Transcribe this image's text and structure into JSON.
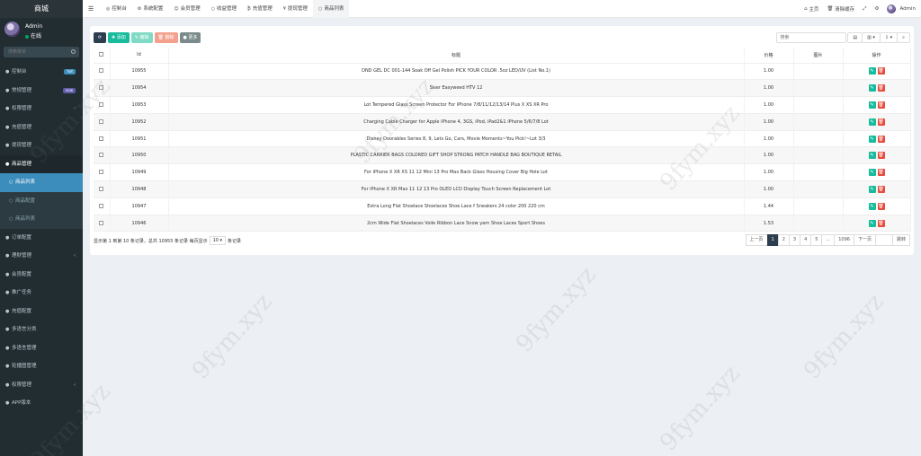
{
  "sidebar": {
    "brand": "商城",
    "user": {
      "name": "Admin",
      "status": "在线"
    },
    "search_placeholder": "搜索菜单",
    "items": [
      {
        "label": "控制台",
        "icon": "dashboard-icon",
        "badge": "hot",
        "badge_color": "#3c8dbc"
      },
      {
        "label": "常规管理",
        "icon": "cog-icon",
        "badge": "new",
        "badge_color": "#605ca8"
      },
      {
        "label": "权限管理",
        "icon": "group-icon",
        "chevron": "‹"
      },
      {
        "label": "充值管理",
        "icon": "money-icon"
      },
      {
        "label": "提现管理",
        "icon": "yen-icon"
      },
      {
        "label": "商品管理",
        "icon": "shop-icon",
        "open": true
      },
      {
        "label": "商品列表",
        "sub": true,
        "active": true
      },
      {
        "label": "商品配置",
        "sub": true
      },
      {
        "label": "商品列表",
        "sub": true
      },
      {
        "label": "订单配置",
        "icon": "circle-icon"
      },
      {
        "label": "理财管理",
        "icon": "list-icon",
        "chevron": "‹"
      },
      {
        "label": "会员配置",
        "icon": "user-icon"
      },
      {
        "label": "推广任务",
        "icon": "link-icon"
      },
      {
        "label": "充值配置",
        "icon": "card-icon"
      },
      {
        "label": "多语言分类",
        "icon": "tag-icon"
      },
      {
        "label": "多语言管理",
        "icon": "edit-icon"
      },
      {
        "label": "轮播图管理",
        "icon": "image-icon"
      },
      {
        "label": "权限管理",
        "icon": "users-icon",
        "chevron": "‹"
      },
      {
        "label": "APP版本",
        "icon": "circle-icon"
      }
    ]
  },
  "topbar": {
    "tabs": [
      {
        "label": "控制台",
        "icon": "◎"
      },
      {
        "label": "系统配置",
        "icon": "⚙"
      },
      {
        "label": "会员管理",
        "icon": "☺"
      },
      {
        "label": "收益管理",
        "icon": "○"
      },
      {
        "label": "充值管理",
        "icon": "₿"
      },
      {
        "label": "提现管理",
        "icon": "¥"
      },
      {
        "label": "商品列表",
        "icon": "○",
        "active": true
      }
    ],
    "home": "主页",
    "clear_cache": "清除缓存",
    "user": "Admin"
  },
  "toolbar": {
    "add": "✚ 添加",
    "edit": "✎ 编辑",
    "delete": "🗑 删除",
    "more": "● 更多"
  },
  "search": {
    "placeholder": "搜索"
  },
  "table": {
    "headers": {
      "id": "Id",
      "title": "标题",
      "price": "价格",
      "image": "图片",
      "ops": "操作"
    },
    "rows": [
      {
        "id": "10955",
        "title": "DND GEL DC 001-144 Soak Off Gel Polish PICK YOUR COLOR .5oz LED/UV (List No.1)",
        "price": "1.00"
      },
      {
        "id": "10954",
        "title": "Siser Easyweed HTV 12",
        "price": "1.00"
      },
      {
        "id": "10953",
        "title": "Lot Tempered Glass Screen Protector For iPhone 7/8/11/12/13/14 Plus X XS XR Pro",
        "price": "1.00"
      },
      {
        "id": "10952",
        "title": "Charging Cable Charger for Apple iPhone 4, 3GS, iPod, iPad2&1 iPhone 5/6/7/8 Lot",
        "price": "1.00"
      },
      {
        "id": "10951",
        "title": "Disney Doorables Series 8, 9, Lets Go, Cars, Movie Moments~You Pick!~Lot 3/3",
        "price": "1.00"
      },
      {
        "id": "10950",
        "title": "PLASTIC CARRIER BAGS COLORED GIFT SHOP STRONG PATCH HANDLE BAG BOUTIQUE RETAIL",
        "price": "1.00"
      },
      {
        "id": "10949",
        "title": "For iPhone X XR XS 11 12 Mini 13 Pro Max Back Glass Housing Cover Big Hole Lot",
        "price": "1.00"
      },
      {
        "id": "10948",
        "title": "For iPhone X XR Max 11 12 13 Pro OLED LCD Display Touch Screen Replacement Lot",
        "price": "1.00"
      },
      {
        "id": "10947",
        "title": "Extra Long Flat Shoelace Shoelaces Shoe Lace f Sneakers 24 color 200 220 cm",
        "price": "1.44"
      },
      {
        "id": "10946",
        "title": "2cm Wide Flat Shoelaces Voile Ribbon Lace Snow yarn Shoe Laces Sport Shoes",
        "price": "1.53"
      }
    ]
  },
  "pager": {
    "info_prefix": "显示第 1 到第 10 条记录，总共 10955 条记录 每页显示",
    "page_size": "10 ▾",
    "info_suffix": "条记录",
    "prev": "上一页",
    "pages": [
      "1",
      "2",
      "3",
      "4",
      "5",
      "...",
      "1096"
    ],
    "next": "下一页",
    "jump": "跳转"
  },
  "watermark": "9fym.xyz"
}
